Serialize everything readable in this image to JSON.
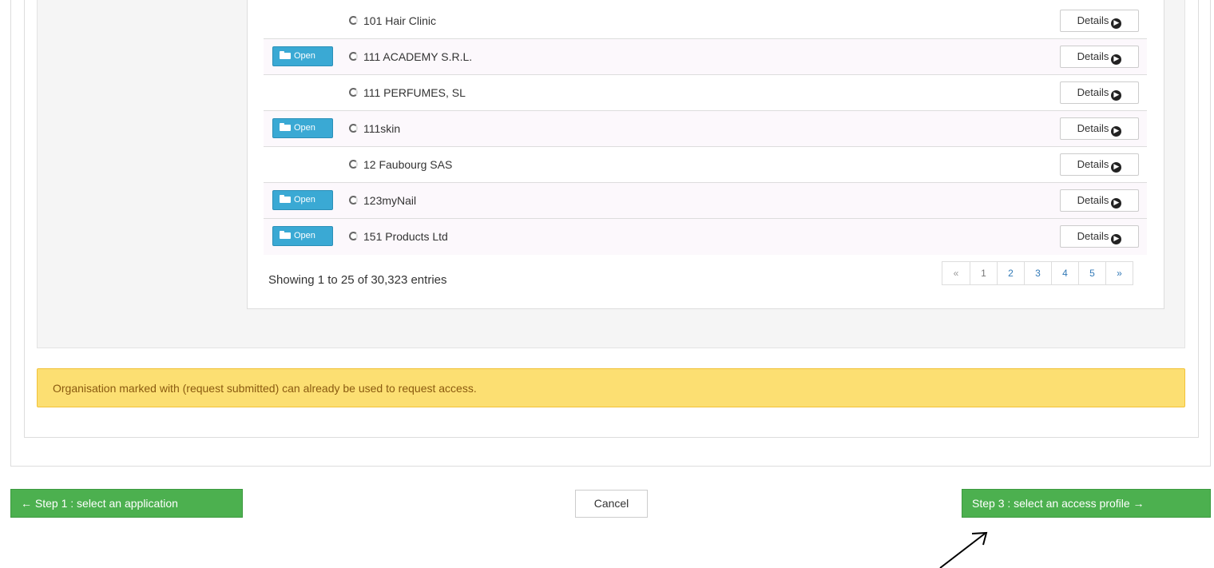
{
  "organisations": [
    {
      "name": "101 Hair Clinic",
      "open": false
    },
    {
      "name": "111 ACADEMY S.R.L.",
      "open": true
    },
    {
      "name": "111 PERFUMES, SL",
      "open": false
    },
    {
      "name": "111skin",
      "open": true
    },
    {
      "name": "12 Faubourg SAS",
      "open": false
    },
    {
      "name": "123myNail",
      "open": true
    },
    {
      "name": "151 Products Ltd",
      "open": true
    }
  ],
  "labels": {
    "open_button": "Open",
    "details_button": "Details",
    "showing": "Showing 1 to 25 of 30,323 entries"
  },
  "pagination": {
    "prev": "«",
    "pages": [
      "1",
      "2",
      "3",
      "4",
      "5"
    ],
    "next": "»",
    "current": "1"
  },
  "alert": {
    "text": "Organisation marked with (request submitted) can already be used to request access."
  },
  "footer": {
    "step1_label": "← Step 1 : select an application",
    "cancel_label": "Cancel",
    "step3_label": "Step 3 : select an access profile →"
  },
  "icons": {
    "open": "folder-open-icon",
    "details": "arrow-circle-right-icon",
    "annotation": "annotation-arrow"
  },
  "colors": {
    "open_button": "#3aa9d4",
    "alert_background": "#fcdf72",
    "alert_text": "#8a5a10",
    "primary_green": "#4cb04f",
    "link": "#337ab7"
  }
}
